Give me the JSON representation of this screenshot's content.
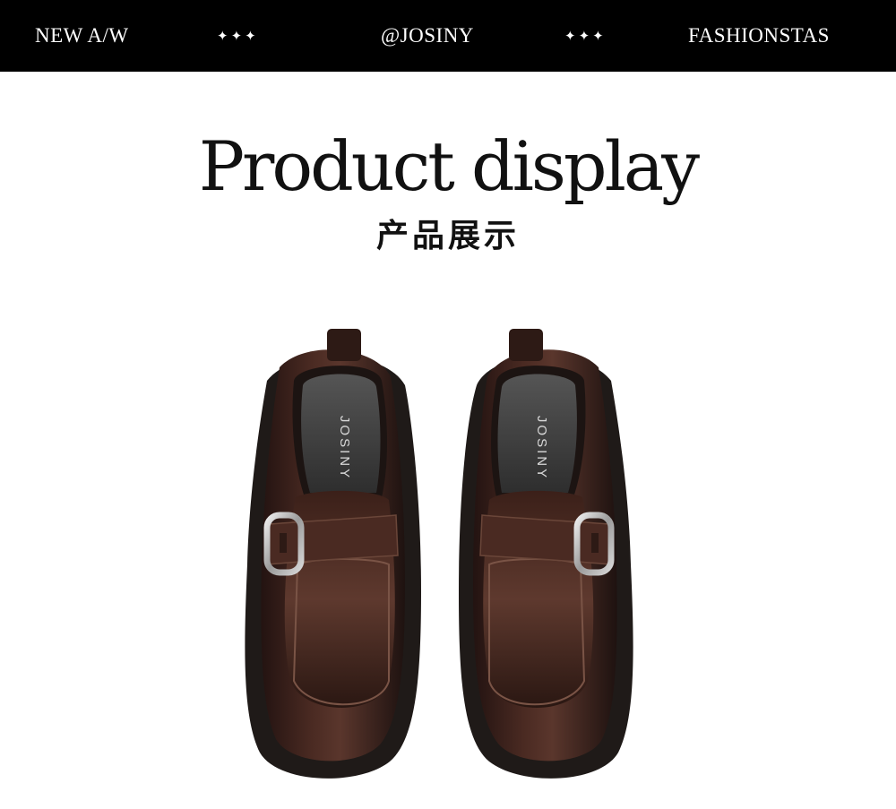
{
  "header": {
    "left_text": "NEW A/W",
    "left_stars": "✦✦✦",
    "center_text": "@JOSINY",
    "right_stars": "✦✦✦",
    "right_text": "FASHIONSTAS",
    "background": "#000000",
    "text_color": "#ffffff"
  },
  "section": {
    "title_en": "Product display",
    "title_cn": "产品展示"
  },
  "product": {
    "insole_brand": "JOSINY",
    "leather_color": "#3a201a",
    "buckle_color": "#c7c7c7",
    "insole_color": "#3c3c3c",
    "sole_color": "#1f1a18"
  }
}
